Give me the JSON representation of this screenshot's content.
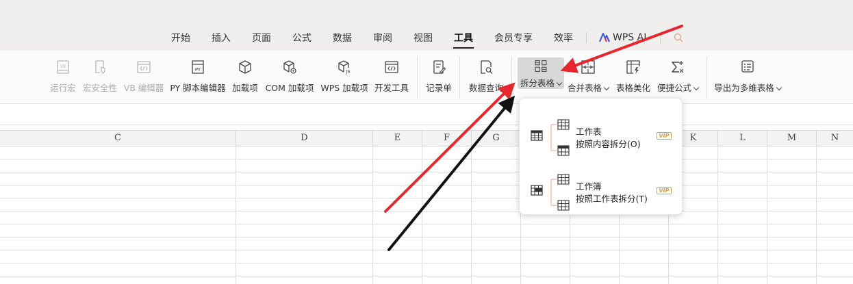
{
  "tabs": [
    {
      "label": "开始"
    },
    {
      "label": "插入"
    },
    {
      "label": "页面"
    },
    {
      "label": "公式"
    },
    {
      "label": "数据"
    },
    {
      "label": "审阅"
    },
    {
      "label": "视图"
    },
    {
      "label": "工具",
      "active": true
    },
    {
      "label": "会员专享"
    },
    {
      "label": "效率"
    }
  ],
  "ai_tab": {
    "label": "WPS AI"
  },
  "ribbon": {
    "run_macro": "运行宏",
    "macro_security": "宏安全性",
    "vb_editor": "VB 编辑器",
    "py_editor": "PY 脚本编辑器",
    "addins": "加载项",
    "com_addins": "COM 加载项",
    "wps_addins": "WPS 加载项",
    "dev_tools": "开发工具",
    "record_form": "记录单",
    "data_query": "数据查询",
    "split_table": "拆分表格",
    "merge_table": "合并表格",
    "table_beautify": "表格美化",
    "quick_formula": "便捷公式",
    "export_multidim": "导出为多维表格"
  },
  "columns": [
    "C",
    "D",
    "E",
    "F",
    "G",
    "K",
    "L",
    "M",
    "N"
  ],
  "dropdown": {
    "items": [
      {
        "title": "工作表",
        "desc": "按照内容拆分(O)",
        "badge": "VIP"
      },
      {
        "title": "工作簿",
        "desc": "按照工作表拆分(T)",
        "badge": "VIP"
      }
    ]
  },
  "colors": {
    "annotation_red": "#e8262e",
    "annotation_black": "#111111",
    "vip_gold": "#d7a04b",
    "ai_logo": "#3b5bdb"
  }
}
